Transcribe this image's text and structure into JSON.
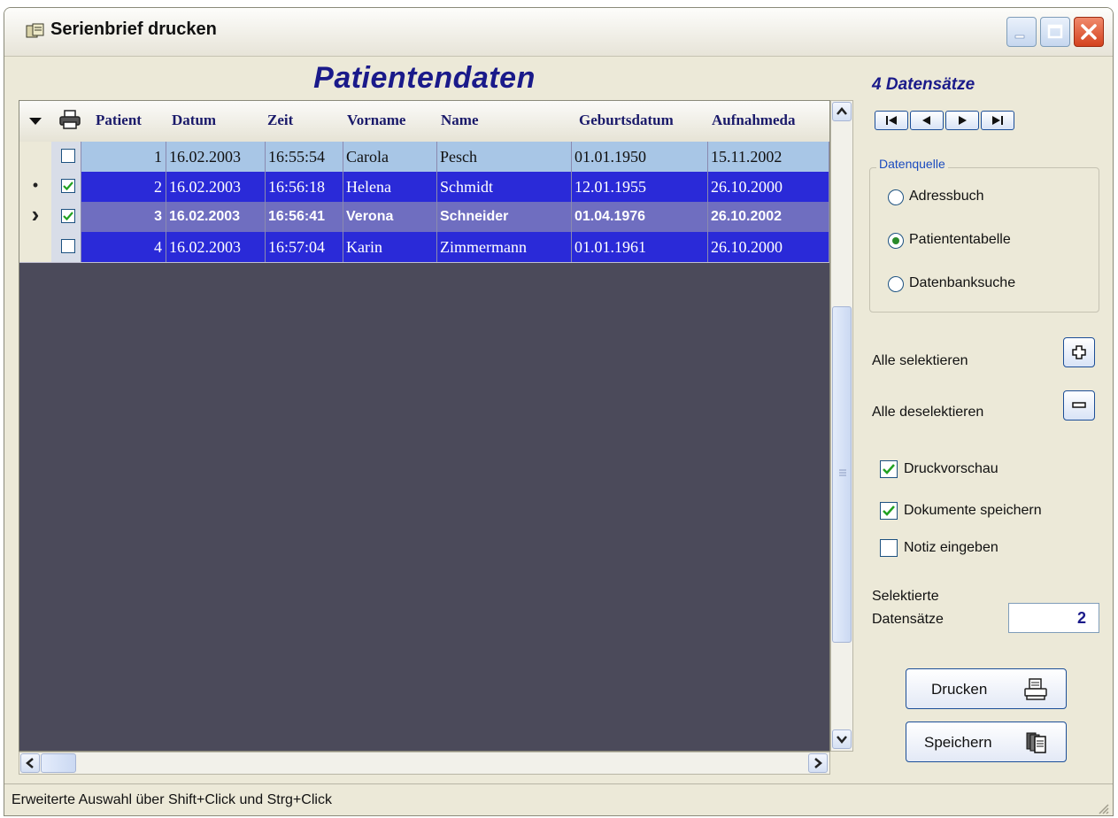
{
  "window": {
    "title": "Serienbrief drucken"
  },
  "caption": "Patientendaten",
  "grid": {
    "columns": [
      {
        "label": "Patient"
      },
      {
        "label": "Datum"
      },
      {
        "label": "Zeit"
      },
      {
        "label": "Vorname"
      },
      {
        "label": "Name"
      },
      {
        "label": "Geburtsdatum"
      },
      {
        "label": "Aufnahmeda"
      }
    ],
    "rows": [
      {
        "indicator": "",
        "checked": false,
        "bold": false,
        "bg": "#a8c6e6",
        "fg": "#111111",
        "cells": [
          "1",
          "16.02.2003",
          "16:55:54",
          "Carola",
          "Pesch",
          "01.01.1950",
          "15.11.2002"
        ]
      },
      {
        "indicator": "•",
        "checked": true,
        "bold": false,
        "bg": "#2a2ad8",
        "fg": "#ffffff",
        "cells": [
          "2",
          "16.02.2003",
          "16:56:18",
          "Helena",
          "Schmidt",
          "12.01.1955",
          "26.10.2000"
        ]
      },
      {
        "indicator": "›",
        "checked": true,
        "bold": true,
        "bg": "#6f6ec0",
        "fg": "#ffffff",
        "cells": [
          "3",
          "16.02.2003",
          "16:56:41",
          "Verona",
          "Schneider",
          "01.04.1976",
          "26.10.2002"
        ]
      },
      {
        "indicator": "",
        "checked": false,
        "bold": false,
        "bg": "#2a2ad8",
        "fg": "#ffffff",
        "cells": [
          "4",
          "16.02.2003",
          "16:57:04",
          "Karin",
          "Zimmermann",
          "01.01.1961",
          "26.10.2000"
        ]
      }
    ]
  },
  "sidebar": {
    "record_count": "4 Datensätze",
    "datasource": {
      "legend": "Datenquelle",
      "options": [
        {
          "label": "Adressbuch",
          "selected": false
        },
        {
          "label": "Patiententabelle",
          "selected": true
        },
        {
          "label": "Datenbanksuche",
          "selected": false
        }
      ]
    },
    "select_all_label": "Alle selektieren",
    "deselect_all_label": "Alle deselektieren",
    "checkboxes": [
      {
        "label": "Druckvorschau",
        "checked": true
      },
      {
        "label": "Dokumente speichern",
        "checked": true
      },
      {
        "label": "Notiz eingeben",
        "checked": false
      }
    ],
    "selected_label_line1": "Selektierte",
    "selected_label_line2": "Datensätze",
    "selected_count": "2",
    "print_button": "Drucken",
    "save_button": "Speichern"
  },
  "status": {
    "text": "Erweiterte Auswahl über Shift+Click und Strg+Click"
  },
  "colors": {
    "grid_background": "#4b4a5a",
    "accent": "#1a1a8a",
    "selected_row": "#2a2ad8",
    "current_row": "#6f6ec0",
    "first_row": "#a8c6e6"
  },
  "icons": [
    "app-icon",
    "minimize-icon",
    "maximize-icon",
    "close-icon",
    "dropdown-arrow-icon",
    "printer-icon",
    "first-record-icon",
    "prev-record-icon",
    "next-record-icon",
    "last-record-icon",
    "plus-icon",
    "minus-icon",
    "checkmark-icon",
    "scroll-up-icon",
    "scroll-down-icon",
    "scroll-left-icon",
    "scroll-right-icon",
    "size-grip-icon"
  ]
}
